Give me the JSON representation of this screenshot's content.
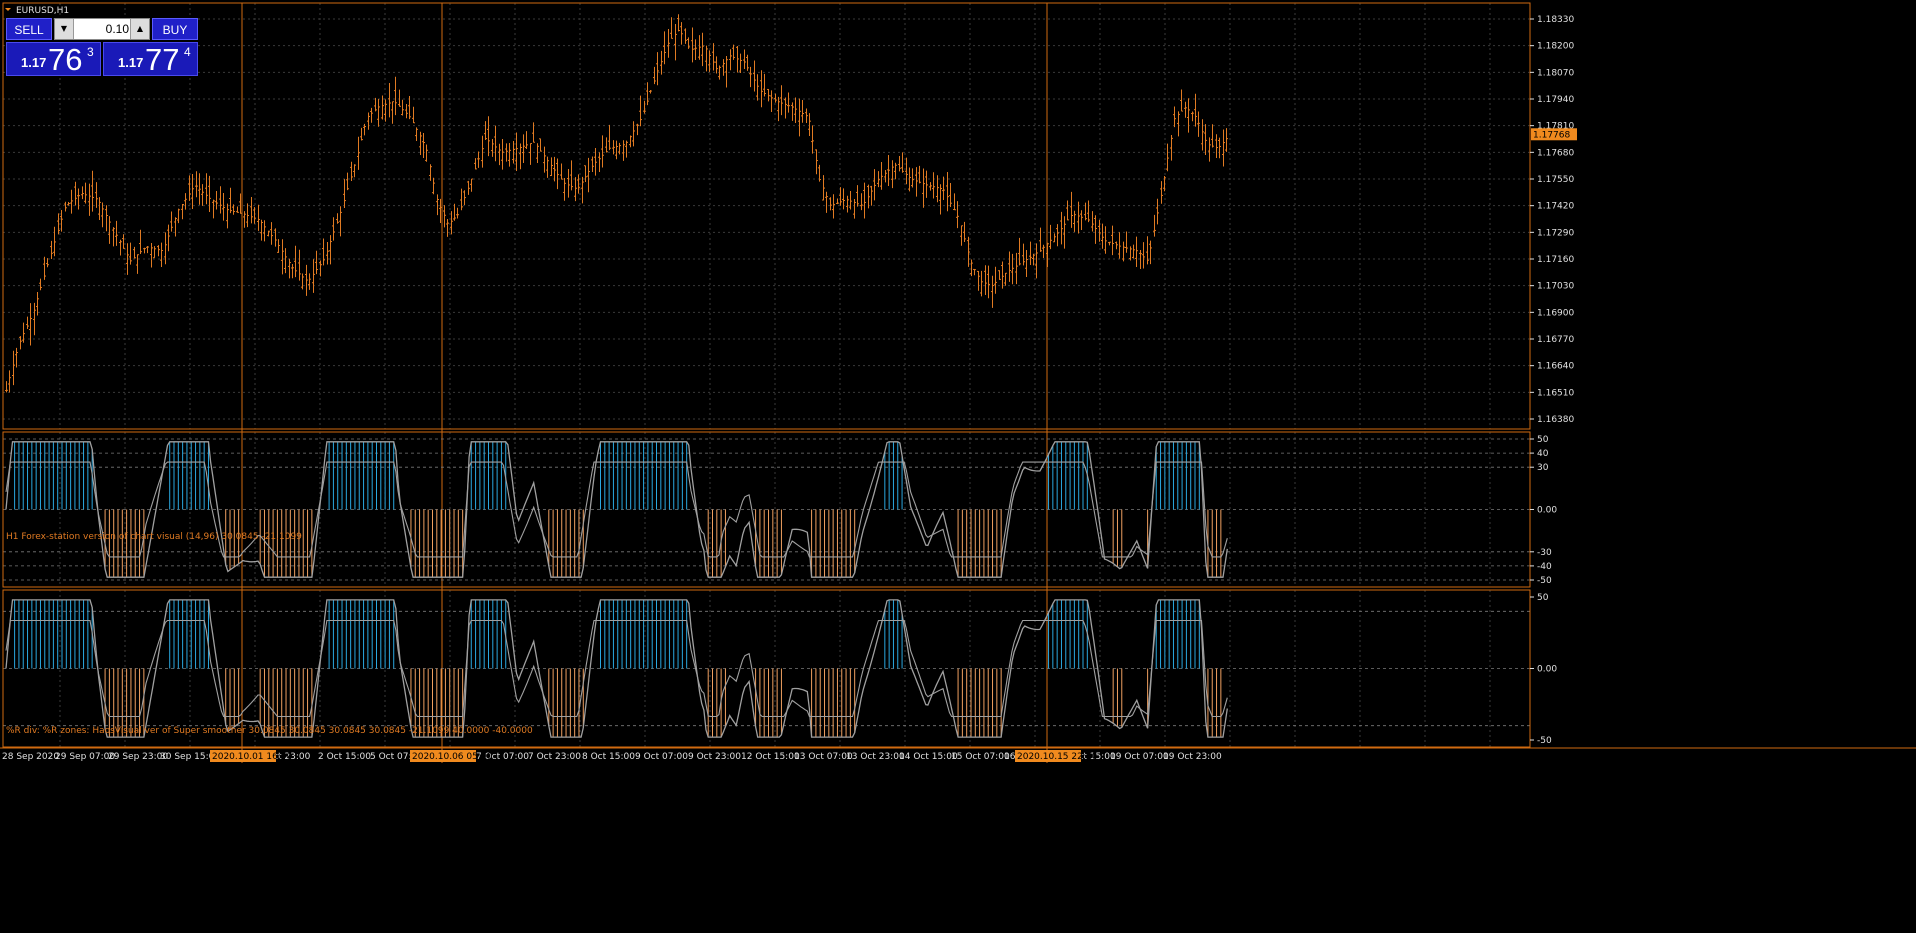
{
  "window": {
    "symbol_title": "EURUSD,H1"
  },
  "trade_panel": {
    "sell_label": "SELL",
    "buy_label": "BUY",
    "lot_value": "0.10",
    "sell_price_prefix": "1.17",
    "sell_price_big": "76",
    "sell_price_sup": "3",
    "buy_price_prefix": "1.17",
    "buy_price_big": "77",
    "buy_price_sup": "4"
  },
  "main_axis": {
    "labels": [
      "1.18330",
      "1.18200",
      "1.18070",
      "1.17940",
      "1.17810",
      "1.17680",
      "1.17550",
      "1.17420",
      "1.17290",
      "1.17160",
      "1.17030",
      "1.16900",
      "1.16770",
      "1.16640",
      "1.16510",
      "1.16380"
    ],
    "current_price": "1.17768"
  },
  "indicator1": {
    "title": "H1 Forex-station version of chart visual (14,96) 30.0845 -21.1099",
    "axis_labels": [
      "50",
      "40",
      "30",
      "0.00",
      "-30",
      "-40",
      "-50"
    ]
  },
  "indicator2": {
    "title": "%R div: %R zones:  HaosVisual ver of Super smoother 30.0845 30.0845 30.0845 30.0845 -21.1099 40.0000 -40.0000",
    "axis_labels": [
      "50",
      "0.00",
      "-50"
    ]
  },
  "time_axis": {
    "labels": [
      "28 Sep 2020",
      "29 Sep 07:00",
      "29 Sep 23:00",
      "30 Sep 15:00",
      "1 Oct 07:00",
      "Oct 23:00",
      "2 Oct 15:00",
      "5 Oct 07:00",
      "6 Oct 23:00",
      "7 Oct 07:00",
      "7 Oct 23:00",
      "8 Oct 15:00",
      "9 Oct 07:00",
      "9 Oct 23:00",
      "12 Oct 15:00",
      "13 Oct 07:00",
      "13 Oct 23:00",
      "14 Oct 15:00",
      "15 Oct 07:00",
      "16 Oct 07:00",
      "16 Oct 15:00",
      "19 Oct 07:00",
      "19 Oct 23:00"
    ],
    "highlights": [
      "2020.10.01 16:00",
      "2020.10.06 05:00",
      "2020.10.15 22:00"
    ]
  },
  "colors": {
    "background": "#000000",
    "candle": "#e07a22",
    "frame": "#d06a10",
    "text": "#e0e0e0",
    "grid": "#3a3a3a",
    "overbought": "#2aa8e0",
    "oversold": "#f0a060",
    "oscillator": "#a0a0a0",
    "badge": "#f08a1e"
  },
  "chart_data": {
    "type": "candlestick",
    "symbol": "EURUSD",
    "timeframe": "H1",
    "y_range": [
      1.1638,
      1.1833
    ],
    "close_path": [
      [
        0,
        1.1652
      ],
      [
        12,
        1.1675
      ],
      [
        25,
        1.169
      ],
      [
        40,
        1.1716
      ],
      [
        55,
        1.1742
      ],
      [
        70,
        1.1748
      ],
      [
        85,
        1.1745
      ],
      [
        100,
        1.173
      ],
      [
        115,
        1.1715
      ],
      [
        130,
        1.1722
      ],
      [
        145,
        1.172
      ],
      [
        160,
        1.174
      ],
      [
        175,
        1.1752
      ],
      [
        190,
        1.1745
      ],
      [
        205,
        1.174
      ],
      [
        220,
        1.1738
      ],
      [
        235,
        1.1735
      ],
      [
        250,
        1.1725
      ],
      [
        265,
        1.1712
      ],
      [
        280,
        1.1705
      ],
      [
        295,
        1.1716
      ],
      [
        310,
        1.1738
      ],
      [
        325,
        1.1765
      ],
      [
        335,
        1.1785
      ],
      [
        345,
        1.179
      ],
      [
        360,
        1.1793
      ],
      [
        375,
        1.1785
      ],
      [
        390,
        1.177
      ],
      [
        400,
        1.1745
      ],
      [
        410,
        1.1733
      ],
      [
        420,
        1.1738
      ],
      [
        432,
        1.1755
      ],
      [
        445,
        1.1775
      ],
      [
        460,
        1.1768
      ],
      [
        475,
        1.177
      ],
      [
        490,
        1.1773
      ],
      [
        505,
        1.1762
      ],
      [
        518,
        1.1753
      ],
      [
        530,
        1.175
      ],
      [
        545,
        1.1762
      ],
      [
        560,
        1.177
      ],
      [
        575,
        1.1772
      ],
      [
        590,
        1.1785
      ],
      [
        605,
        1.1808
      ],
      [
        615,
        1.1822
      ],
      [
        625,
        1.1828
      ],
      [
        635,
        1.1818
      ],
      [
        648,
        1.182
      ],
      [
        660,
        1.1808
      ],
      [
        672,
        1.1815
      ],
      [
        685,
        1.1812
      ],
      [
        700,
        1.1798
      ],
      [
        715,
        1.1793
      ],
      [
        730,
        1.179
      ],
      [
        745,
        1.1785
      ],
      [
        755,
        1.1755
      ],
      [
        765,
        1.1742
      ],
      [
        780,
        1.1745
      ],
      [
        795,
        1.1742
      ],
      [
        810,
        1.1755
      ],
      [
        825,
        1.1762
      ],
      [
        840,
        1.1755
      ],
      [
        855,
        1.1752
      ],
      [
        870,
        1.175
      ],
      [
        885,
        1.1735
      ],
      [
        895,
        1.1715
      ],
      [
        905,
        1.1705
      ],
      [
        915,
        1.1703
      ],
      [
        930,
        1.171
      ],
      [
        945,
        1.1715
      ],
      [
        960,
        1.172
      ],
      [
        975,
        1.1728
      ],
      [
        990,
        1.1738
      ],
      [
        1005,
        1.1735
      ],
      [
        1020,
        1.1725
      ],
      [
        1035,
        1.1722
      ],
      [
        1050,
        1.172
      ],
      [
        1060,
        1.1715
      ],
      [
        1075,
        1.1755
      ],
      [
        1085,
        1.1785
      ],
      [
        1095,
        1.179
      ],
      [
        1105,
        1.1785
      ],
      [
        1115,
        1.1772
      ],
      [
        1125,
        1.177
      ],
      [
        1135,
        1.1776
      ]
    ]
  }
}
